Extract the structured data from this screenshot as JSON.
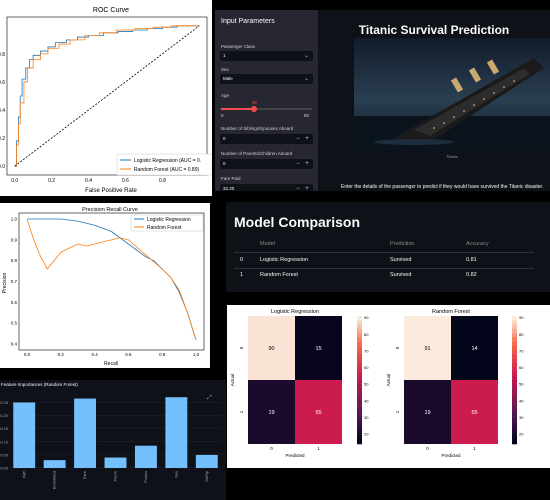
{
  "roc": {
    "title": "ROC Curve",
    "xlabel": "False Positive Rate",
    "legend": [
      "Logistic Regression (AUC = 0.",
      "Random Forest (AUC = 0.89)"
    ],
    "xticks": [
      "0.0",
      "0.2",
      "0.4",
      "0.6",
      "0.8"
    ],
    "yticks": [
      "0.0",
      "0.2",
      "0.4",
      "0.6",
      "0.8"
    ]
  },
  "pr": {
    "title": "Precision Recall Curve",
    "xlabel": "Recall",
    "ylabel": "Precision",
    "legend": [
      "Logistic Regression",
      "Random Forest"
    ],
    "xticks": [
      "0.0",
      "0.2",
      "0.4",
      "0.6",
      "0.8",
      "1.0"
    ],
    "yticks": [
      "0.4",
      "0.5",
      "0.6",
      "0.7",
      "0.8",
      "0.9",
      "1.0"
    ]
  },
  "sidebar": {
    "header": "Input Parameters",
    "passenger_class_label": "Passenger Class",
    "passenger_class_value": "1",
    "sex_label": "Sex",
    "sex_value": "Male",
    "age_label": "Age",
    "age_value": "29",
    "age_min": "0",
    "age_max": "80",
    "age_fraction": 0.36,
    "sibsp_label": "Number of Siblings/Spouses Aboard",
    "sibsp_value": "0",
    "parch_label": "Number of Parents/Children Aboard",
    "parch_value": "0",
    "fare_label": "Fare Paid",
    "fare_value": "32.20",
    "minus": "−",
    "plus": "+"
  },
  "main": {
    "title": "Titanic Survival Prediction",
    "image_caption": "Titanic",
    "instructions": "Enter the details of the passenger to predict if they would have survived the Titanic disaster."
  },
  "comparison": {
    "title": "Model Comparison",
    "headers": [
      "Model",
      "Prediction",
      "Accuracy"
    ],
    "rows": [
      {
        "idx": "0",
        "model": "Logistic Regression",
        "prediction": "Survived",
        "accuracy": "0.81"
      },
      {
        "idx": "1",
        "model": "Random Forest",
        "prediction": "Survived",
        "accuracy": "0.82"
      }
    ]
  },
  "heatmaps": [
    {
      "title": "Logistic Regression",
      "values": [
        [
          90,
          15
        ],
        [
          19,
          55
        ]
      ],
      "xlabel": "Predicted",
      "ylabel": "Actual",
      "xticks": [
        "0",
        "1"
      ],
      "yticks": [
        "0",
        "1"
      ],
      "cbar_ticks": [
        "90",
        "80",
        "70",
        "60",
        "50",
        "40",
        "30",
        "20"
      ]
    },
    {
      "title": "Random Forest",
      "values": [
        [
          91,
          14
        ],
        [
          19,
          55
        ]
      ],
      "xlabel": "Predicted",
      "ylabel": "Actual",
      "xticks": [
        "0",
        "1"
      ],
      "yticks": [
        "0",
        "1"
      ],
      "cbar_ticks": [
        "90",
        "80",
        "70",
        "60",
        "50",
        "40",
        "30",
        "20"
      ]
    }
  ],
  "feature": {
    "title": "Feature Importances (Random Forest)",
    "categories": [
      "Age",
      "Embarked",
      "Fare",
      "Parch",
      "Pclass",
      "Sex",
      "SibSp"
    ],
    "yticks": [
      "0.25",
      "0.20",
      "0.15",
      "0.10",
      "0.05",
      "0.00"
    ]
  },
  "chart_data": [
    {
      "type": "line",
      "title": "ROC Curve",
      "xlabel": "False Positive Rate",
      "xlim": [
        0,
        1
      ],
      "ylim": [
        0,
        1
      ],
      "series": [
        {
          "name": "Logistic Regression (AUC = 0.",
          "x": [
            0,
            0.01,
            0.02,
            0.03,
            0.04,
            0.06,
            0.08,
            0.1,
            0.14,
            0.18,
            0.22,
            0.28,
            0.34,
            0.4,
            0.48,
            0.56,
            0.64,
            0.72,
            0.8,
            0.88,
            1.0
          ],
          "y": [
            0,
            0.18,
            0.35,
            0.5,
            0.62,
            0.7,
            0.76,
            0.79,
            0.82,
            0.85,
            0.88,
            0.9,
            0.92,
            0.93,
            0.95,
            0.96,
            0.97,
            0.98,
            0.99,
            1.0,
            1.0
          ]
        },
        {
          "name": "Random Forest (AUC = 0.89)",
          "x": [
            0,
            0.01,
            0.02,
            0.03,
            0.05,
            0.07,
            0.1,
            0.14,
            0.18,
            0.24,
            0.3,
            0.38,
            0.46,
            0.55,
            0.65,
            0.75,
            0.85,
            1.0
          ],
          "y": [
            0,
            0.15,
            0.3,
            0.45,
            0.6,
            0.7,
            0.76,
            0.8,
            0.84,
            0.87,
            0.9,
            0.93,
            0.95,
            0.97,
            0.98,
            0.99,
            1.0,
            1.0
          ]
        },
        {
          "name": "",
          "x": [
            0,
            1
          ],
          "y": [
            0,
            1
          ],
          "style": "dashed"
        }
      ],
      "legend_position": "lower right"
    },
    {
      "type": "line",
      "title": "Precision Recall Curve",
      "xlabel": "Recall",
      "ylabel": "Precision",
      "xlim": [
        0,
        1
      ],
      "ylim": [
        0.4,
        1.02
      ],
      "series": [
        {
          "name": "Logistic Regression",
          "x": [
            0,
            0.1,
            0.2,
            0.3,
            0.4,
            0.5,
            0.55,
            0.6,
            0.65,
            0.7,
            0.75,
            0.8,
            0.85,
            0.9,
            0.95,
            0.98,
            1.0
          ],
          "y": [
            1.0,
            1.0,
            1.0,
            0.99,
            0.97,
            0.94,
            0.91,
            0.88,
            0.85,
            0.82,
            0.8,
            0.76,
            0.72,
            0.65,
            0.55,
            0.47,
            0.42
          ]
        },
        {
          "name": "Random Forest",
          "x": [
            0,
            0.04,
            0.08,
            0.12,
            0.16,
            0.2,
            0.25,
            0.3,
            0.35,
            0.4,
            0.45,
            0.5,
            0.55,
            0.6,
            0.7,
            0.8,
            0.85,
            0.9,
            0.95,
            1.0
          ],
          "y": [
            1.0,
            0.9,
            0.82,
            0.76,
            0.8,
            0.84,
            0.86,
            0.88,
            0.87,
            0.88,
            0.89,
            0.9,
            0.91,
            0.9,
            0.83,
            0.76,
            0.72,
            0.66,
            0.55,
            0.42
          ]
        }
      ],
      "legend_position": "upper right"
    },
    {
      "type": "heatmap",
      "title": "Logistic Regression",
      "xlabel": "Predicted",
      "ylabel": "Actual",
      "x": [
        "0",
        "1"
      ],
      "y": [
        "0",
        "1"
      ],
      "values": [
        [
          90,
          15
        ],
        [
          19,
          55
        ]
      ]
    },
    {
      "type": "heatmap",
      "title": "Random Forest",
      "xlabel": "Predicted",
      "ylabel": "Actual",
      "x": [
        "0",
        "1"
      ],
      "y": [
        "0",
        "1"
      ],
      "values": [
        [
          91,
          14
        ],
        [
          19,
          55
        ]
      ]
    },
    {
      "type": "bar",
      "title": "Feature Importances (Random Forest)",
      "categories": [
        "Age",
        "Embarked",
        "Fare",
        "Parch",
        "Pclass",
        "Sex",
        "SibSp"
      ],
      "values": [
        0.25,
        0.03,
        0.265,
        0.04,
        0.085,
        0.27,
        0.05
      ],
      "ylim": [
        0,
        0.29
      ],
      "color": "#74c0fc"
    }
  ]
}
